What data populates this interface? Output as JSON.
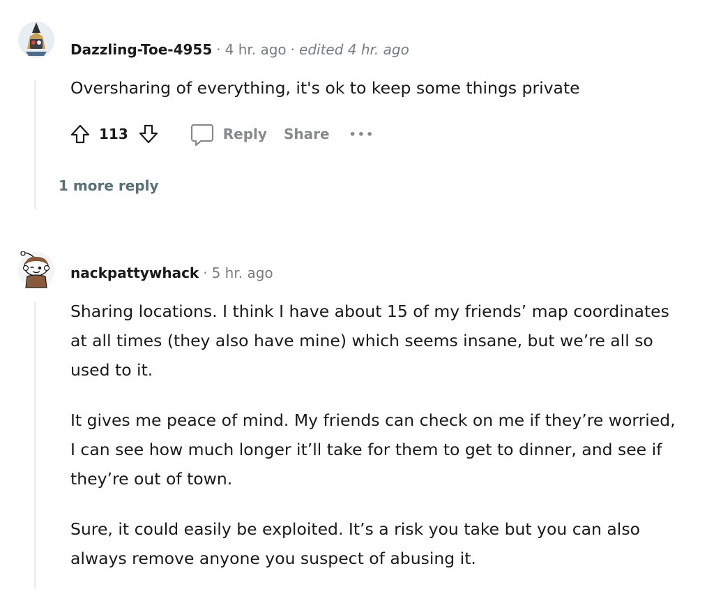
{
  "comments": [
    {
      "author": "Dazzling-Toe-4955",
      "time": "4 hr. ago",
      "edited": "edited 4 hr. ago",
      "body": [
        "Oversharing of everything, it's ok to keep some things private"
      ],
      "votes": "113",
      "actions": {
        "reply": "Reply",
        "share": "Share",
        "more": "•••"
      },
      "more_replies": "1 more reply",
      "avatar_icon": "robot-knight-avatar"
    },
    {
      "author": "nackpattywhack",
      "time": "5 hr. ago",
      "body": [
        "Sharing locations. I think I have about 15 of my friends’ map coordinates at all times (they also have mine) which seems insane, but we’re all so used to it.",
        "It gives me peace of mind. My friends can check on me if they’re worried, I can see how much longer it’ll take for them to get to dinner, and see if they’re out of town.",
        "Sure, it could easily be exploited. It’s a risk you take but you can also always remove anyone you suspect of abusing it."
      ],
      "avatar_icon": "snoo-avatar"
    }
  ],
  "separators": {
    "dot": "·"
  },
  "colors": {
    "thread_line": "#edeff1",
    "meta_text": "#787c7e",
    "action_text": "#878a8c",
    "more_replies_text": "#576f76"
  }
}
